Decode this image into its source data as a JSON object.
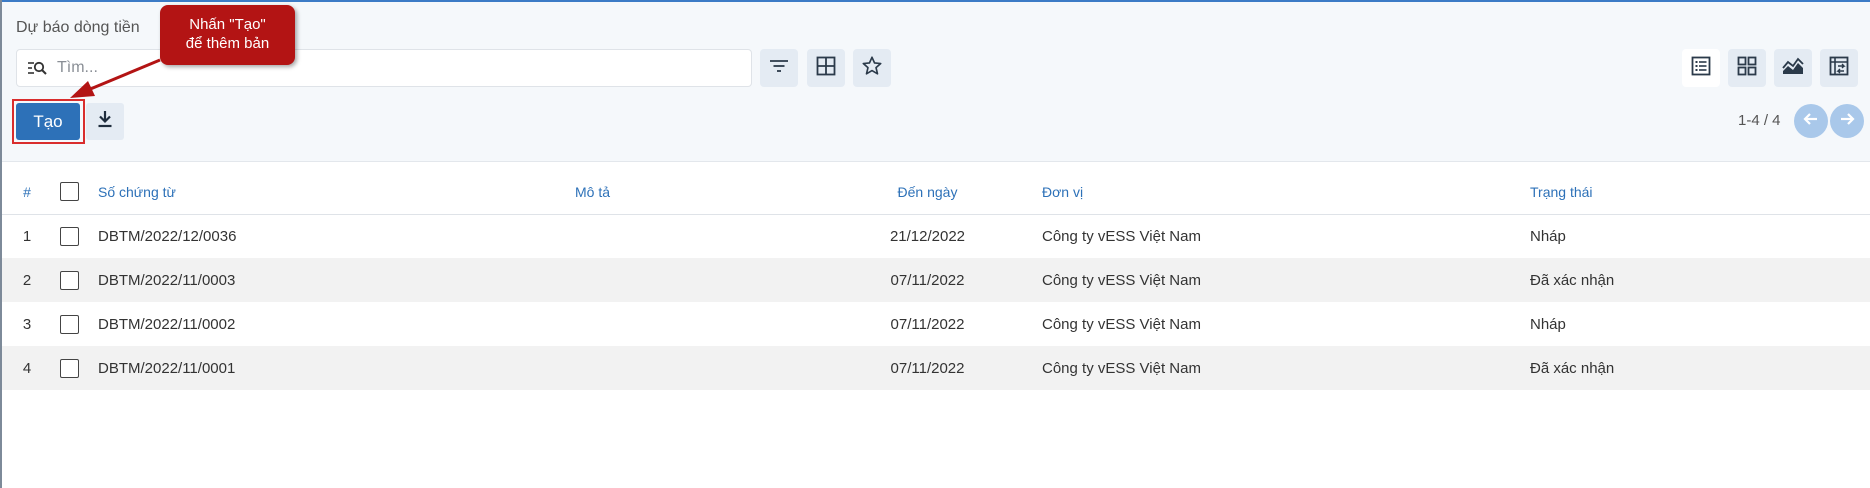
{
  "breadcrumb": "Dự báo dòng tiền",
  "tooltip": {
    "line1": "Nhấn \"Tạo\"",
    "line2": "để thêm bản"
  },
  "search": {
    "placeholder": "Tìm..."
  },
  "toolbar": {
    "filter_icon": "filter-icon",
    "groupby_icon": "grid-icon",
    "favorite_icon": "star-icon",
    "create_label": "Tạo",
    "download_icon": "download-icon"
  },
  "views": [
    "list-view-icon",
    "kanban-view-icon",
    "graph-view-icon",
    "pivot-view-icon"
  ],
  "pager": {
    "text": "1-4 / 4"
  },
  "table": {
    "headers": {
      "num": "#",
      "doc": "Số chứng từ",
      "desc": "Mô tả",
      "date": "Đến ngày",
      "unit": "Đơn vị",
      "status": "Trạng thái"
    },
    "rows": [
      {
        "num": "1",
        "doc": "DBTM/2022/12/0036",
        "desc": "",
        "date": "21/12/2022",
        "unit": "Công ty vESS Việt Nam",
        "status": "Nháp"
      },
      {
        "num": "2",
        "doc": "DBTM/2022/11/0003",
        "desc": "",
        "date": "07/11/2022",
        "unit": "Công ty vESS Việt Nam",
        "status": "Đã xác nhận"
      },
      {
        "num": "3",
        "doc": "DBTM/2022/11/0002",
        "desc": "",
        "date": "07/11/2022",
        "unit": "Công ty vESS Việt Nam",
        "status": "Nháp"
      },
      {
        "num": "4",
        "doc": "DBTM/2022/11/0001",
        "desc": "",
        "date": "07/11/2022",
        "unit": "Công ty vESS Việt Nam",
        "status": "Đã xác nhận"
      }
    ]
  },
  "colors": {
    "accent": "#2d71b8",
    "tooltip": "#b31414",
    "highlight": "#d92d2d"
  }
}
